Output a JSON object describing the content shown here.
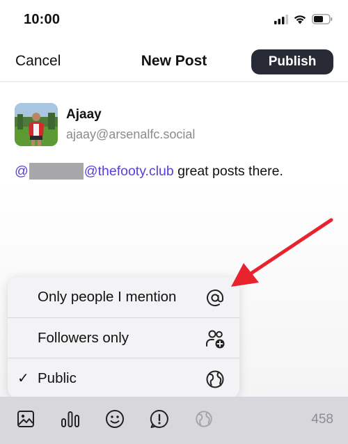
{
  "status_bar": {
    "time": "10:00"
  },
  "nav": {
    "cancel_label": "Cancel",
    "title": "New Post",
    "publish_label": "Publish"
  },
  "author": {
    "name": "Ajaay",
    "handle": "ajaay@arsenalfc.social"
  },
  "post": {
    "mention_prefix": "@",
    "mention_domain": "@thefooty.club",
    "body": " great posts there."
  },
  "visibility_menu": {
    "items": [
      {
        "label": "Only people I mention",
        "icon": "at-icon",
        "selected": false
      },
      {
        "label": "Followers only",
        "icon": "followers-add-icon",
        "selected": false
      },
      {
        "label": "Public",
        "icon": "globe-icon",
        "selected": true,
        "check": "✓"
      }
    ]
  },
  "toolbar": {
    "icons": [
      "image-icon",
      "poll-icon",
      "emoji-icon",
      "content-warning-icon",
      "visibility-globe-icon"
    ],
    "char_count": "458"
  },
  "colors": {
    "accent": "#5a3fd6",
    "publish_bg": "#282a36",
    "arrow": "#e8232e",
    "toolbar_bg": "#d8d8dc"
  }
}
